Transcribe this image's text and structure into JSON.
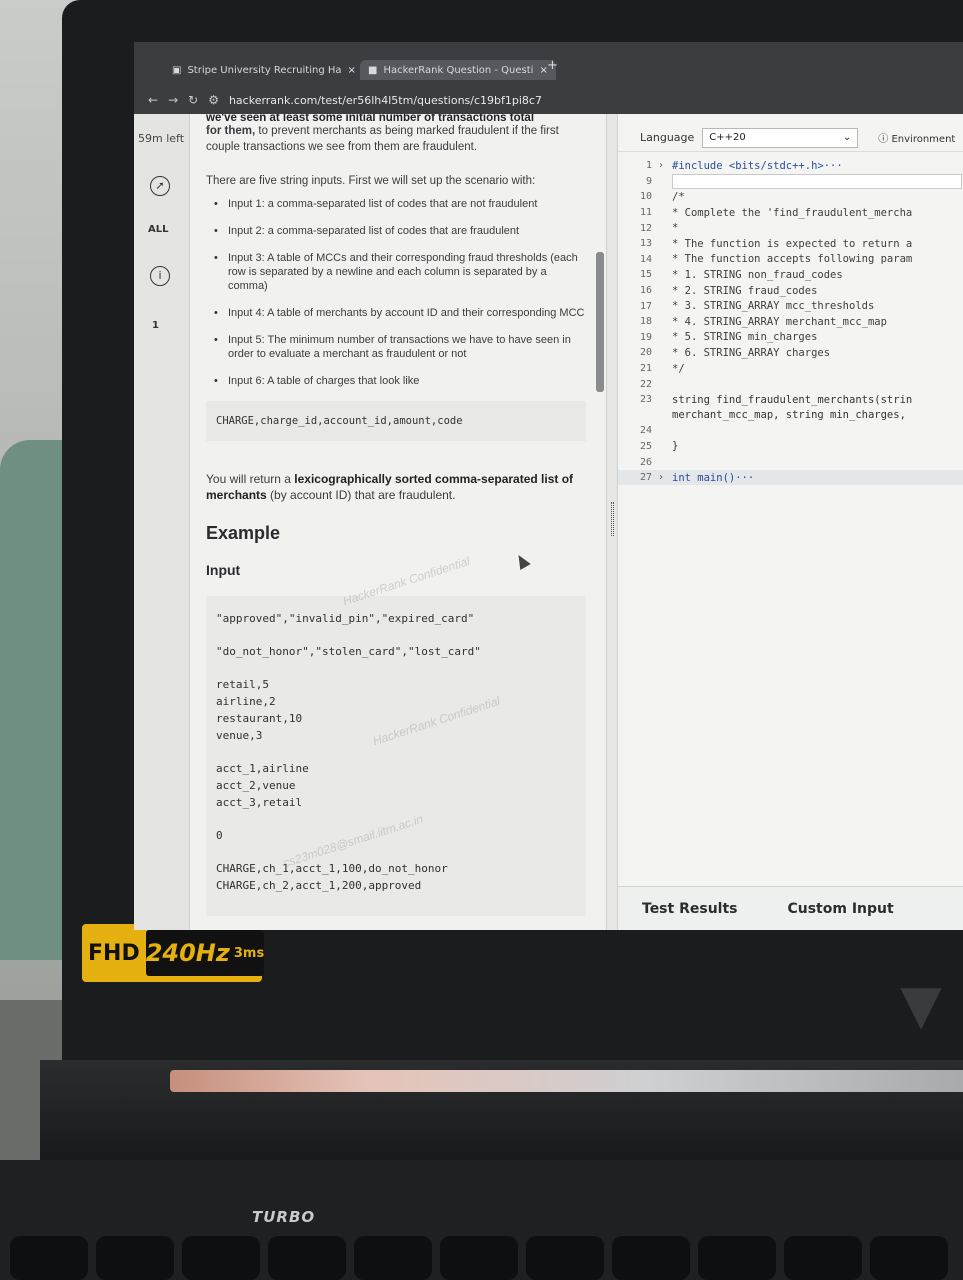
{
  "browser": {
    "tabs": [
      {
        "label": "Stripe University Recruiting Ha"
      },
      {
        "label": "HackerRank Question - Questi"
      }
    ],
    "url": "hackerrank.com/test/er56lh4l5tm/questions/c19bf1pi8c7"
  },
  "rail": {
    "time_left": "59m left",
    "filter_label": "ALL",
    "question_number": "1"
  },
  "problem": {
    "cut_line": "we've seen at least some initial number of transactions total",
    "intro_bold": "for them,",
    "intro_rest": " to prevent merchants as being marked fraudulent if the first couple transactions we see from them are fraudulent.",
    "inputs_intro": "There are five string inputs. First we will set up the scenario with:",
    "inputs": [
      "Input 1: a comma-separated list of codes that are not fraudulent",
      "Input 2: a comma-separated list of codes that are fraudulent",
      "Input 3: A table of MCCs and their corresponding fraud thresholds (each row is separated by a newline and each column is separated by a comma)",
      "Input 4: A table of merchants by account ID and their corresponding MCC",
      "Input 5: The minimum number of transactions we have to have seen in order to evaluate a merchant as fraudulent or not",
      "Input 6: A table of charges that look like"
    ],
    "charge_format": "CHARGE,charge_id,account_id,amount,code",
    "return_pre": "You will return a ",
    "return_bold1": "lexicographically sorted comma-separated list of merchants",
    "return_post": " (by account ID) that are fraudulent.",
    "example_heading": "Example",
    "input_heading": "Input",
    "example_lines": [
      "\"approved\",\"invalid_pin\",\"expired_card\"",
      "",
      "\"do_not_honor\",\"stolen_card\",\"lost_card\"",
      "",
      "retail,5",
      "airline,2",
      "restaurant,10",
      "venue,3",
      "",
      "acct_1,airline",
      "acct_2,venue",
      "acct_3,retail",
      "",
      "0",
      "",
      "CHARGE,ch_1,acct_1,100,do_not_honor",
      "CHARGE,ch_2,acct_1,200,approved"
    ],
    "watermarks": [
      "HackerRank Confidential",
      "cs23m028@smail.iitm.ac.in"
    ]
  },
  "editor": {
    "language_label": "Language",
    "language_value": "C++20",
    "environment_label": "Environment",
    "lines": [
      {
        "n": "1",
        "fold": "›",
        "text": "#include <bits/stdc++.h>···",
        "cls": "kw"
      },
      {
        "n": "9",
        "fold": "",
        "text": "",
        "cls": "cursor"
      },
      {
        "n": "10",
        "fold": "",
        "text": "/*",
        "cls": "com"
      },
      {
        "n": "11",
        "fold": "",
        "text": " * Complete the 'find_fraudulent_mercha",
        "cls": "com"
      },
      {
        "n": "12",
        "fold": "",
        "text": " *",
        "cls": "com"
      },
      {
        "n": "13",
        "fold": "",
        "text": " * The function is expected to return a",
        "cls": "com"
      },
      {
        "n": "14",
        "fold": "",
        "text": " * The function accepts following param",
        "cls": "com"
      },
      {
        "n": "15",
        "fold": "",
        "text": " *  1. STRING non_fraud_codes",
        "cls": "com"
      },
      {
        "n": "16",
        "fold": "",
        "text": " *  2. STRING fraud_codes",
        "cls": "com"
      },
      {
        "n": "17",
        "fold": "",
        "text": " *  3. STRING_ARRAY mcc_thresholds",
        "cls": "com"
      },
      {
        "n": "18",
        "fold": "",
        "text": " *  4. STRING_ARRAY merchant_mcc_map",
        "cls": "com"
      },
      {
        "n": "19",
        "fold": "",
        "text": " *  5. STRING min_charges",
        "cls": "com"
      },
      {
        "n": "20",
        "fold": "",
        "text": " *  6. STRING_ARRAY charges",
        "cls": "com"
      },
      {
        "n": "21",
        "fold": "",
        "text": " */",
        "cls": "com"
      },
      {
        "n": "22",
        "fold": "",
        "text": "",
        "cls": ""
      },
      {
        "n": "23",
        "fold": "",
        "text": "string find_fraudulent_merchants(strin",
        "cls": ""
      },
      {
        "n": "",
        "fold": "",
        "text": "merchant_mcc_map, string min_charges,",
        "cls": ""
      },
      {
        "n": "24",
        "fold": "",
        "text": "",
        "cls": ""
      },
      {
        "n": "25",
        "fold": "",
        "text": "}",
        "cls": ""
      },
      {
        "n": "26",
        "fold": "",
        "text": "",
        "cls": ""
      },
      {
        "n": "27",
        "fold": "›",
        "text": "int main()···",
        "cls": "kw"
      }
    ],
    "test_results_label": "Test Results",
    "custom_input_label": "Custom Input"
  },
  "hardware": {
    "fhd_label": "FHD",
    "refresh_label": "240Hz",
    "response_label": "3ms",
    "turbo_label": "TURBO"
  }
}
